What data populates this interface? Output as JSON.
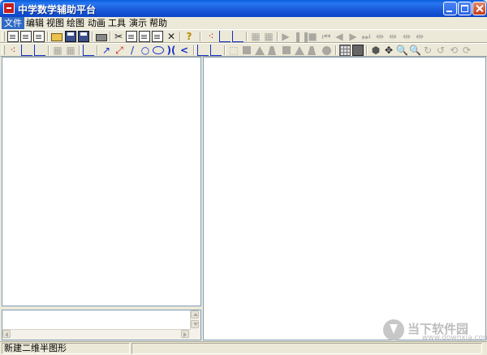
{
  "window": {
    "title": "中学数学辅助平台"
  },
  "menu": [
    {
      "label": "文件",
      "active": true
    },
    {
      "label": "编辑",
      "active": false
    },
    {
      "label": "视图",
      "active": false
    },
    {
      "label": "绘图",
      "active": false
    },
    {
      "label": "动画",
      "active": false
    },
    {
      "label": "工具",
      "active": false
    },
    {
      "label": "演示",
      "active": false
    },
    {
      "label": "帮助",
      "active": false
    }
  ],
  "toolbar1": [
    "new-icon",
    "new-icon",
    "new-icon",
    "open-folder-icon",
    "save-icon",
    "save-as-icon",
    "print-icon",
    "cut-icon",
    "copy-icon",
    "paste-icon",
    "paste-icon",
    "delete-icon",
    "help-icon",
    "point-plot-icon",
    "function-plot-icon",
    "function-plot-icon",
    "graph-disabled-icon",
    "graph-disabled-icon",
    "play-icon",
    "pause-icon",
    "stop-icon",
    "first-icon",
    "prev-icon",
    "next-icon",
    "last-icon",
    "step-icon",
    "step-icon",
    "step-icon"
  ],
  "toolbar2": [
    "points-icon",
    "axes-icon",
    "zoom-axes-icon",
    "graph-disabled-icon",
    "graph-disabled-icon",
    "coordinate-icon",
    "vector-icon",
    "segment-points-icon",
    "line-icon",
    "circle-icon",
    "ellipse-icon",
    "hyperbola-icon",
    "parabola-icon",
    "axis-2d-icon",
    "axis-3d-icon",
    "cube-icon",
    "cylinder-icon",
    "cone-icon",
    "frustum-icon",
    "prism-icon",
    "pyramid-icon",
    "sphere-icon",
    "hemisphere-icon",
    "grid-icon",
    "calculator-icon",
    "polygon-icon",
    "move-icon",
    "zoom-in-icon",
    "zoom-out-icon",
    "rotate-icon",
    "rotate-icon",
    "rotate-icon",
    "rotate-icon"
  ],
  "status": {
    "text": "新建二维半图形"
  },
  "watermark": {
    "brand": "当下软件园",
    "url": "www.downxia.com"
  },
  "colors": {
    "titlebar": "#0A5CDB",
    "menu_active": "#316AC5",
    "face": "#ECE9D8",
    "panel_border": "#7F9DB9"
  }
}
